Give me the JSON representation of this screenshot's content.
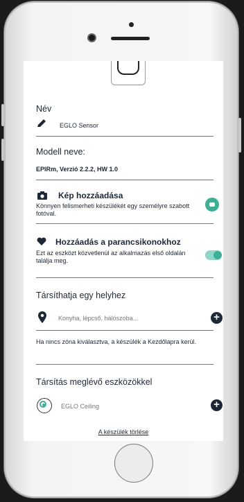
{
  "device": {
    "name_label": "Név",
    "name_value": "EGLO Sensor",
    "model_label": "Modell neve:",
    "model_value": "EPIRm, Verzió 2.2.2, HW 1.0"
  },
  "photo": {
    "title": "Kép hozzáadása",
    "description": "Könnyen felismerheti készülékét egy személyre szabott fotóval.",
    "icon": "camera-icon",
    "toggle_on": true,
    "accent": "#3daf96"
  },
  "shortcuts": {
    "title": "Hozzáadás a parancsikonokhoz",
    "description": "Ezt az eszközt közvetlenül az alkalmazás első oldalán találja meg.",
    "icon": "heart-icon",
    "toggle_on": true
  },
  "location": {
    "title": "Társíthatja egy helyhez",
    "placeholder": "Konyha, lépcső, hálószoba...",
    "hint": "Ha nincs zóna kiválasztva, a készülék a Kezdőlapra kerül."
  },
  "linked": {
    "title": "Társítás meglévő eszközökkel",
    "device": "EGLO Ceiling"
  },
  "delete_label": "A készülék törlése"
}
